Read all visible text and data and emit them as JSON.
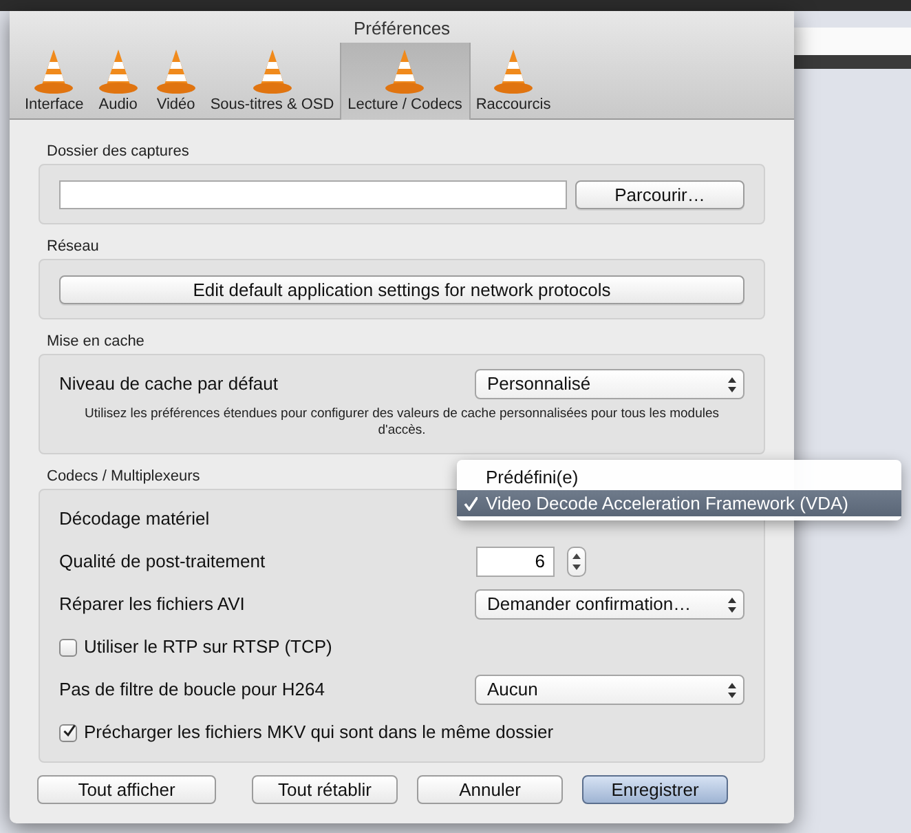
{
  "window": {
    "title": "Préférences"
  },
  "tabs": [
    {
      "label": "Interface",
      "selected": false
    },
    {
      "label": "Audio",
      "selected": false
    },
    {
      "label": "Vidéo",
      "selected": false
    },
    {
      "label": "Sous-titres & OSD",
      "selected": false
    },
    {
      "label": "Lecture / Codecs",
      "selected": true
    },
    {
      "label": "Raccourcis",
      "selected": false
    }
  ],
  "sections": [
    {
      "title": "Dossier des captures",
      "items": [
        {
          "kind": "path",
          "button": "Parcourir…"
        }
      ]
    },
    {
      "title": "Réseau",
      "items": [
        {
          "kind": "button",
          "label": "Edit default application settings for network protocols"
        }
      ]
    },
    {
      "title": "Mise en cache",
      "items": [
        {
          "kind": "select",
          "label": "Niveau de cache par défaut",
          "value": "Personnalisé"
        },
        {
          "kind": "note",
          "text": "Utilisez les préférences étendues pour configurer des valeurs de cache personnalisées pour tous les modules d'accès."
        }
      ]
    },
    {
      "title": "Codecs / Multiplexeurs",
      "items": [
        {
          "kind": "popup",
          "label": "Décodage matériel"
        },
        {
          "kind": "spin",
          "label": "Qualité de post-traitement",
          "value": "6"
        },
        {
          "kind": "select",
          "label": "Réparer les fichiers AVI",
          "value": "Demander confirmation…"
        },
        {
          "kind": "checkbox",
          "label": "Utiliser le RTP sur RTSP (TCP)",
          "checked": false
        },
        {
          "kind": "select",
          "label": "Pas de filtre de boucle pour H264",
          "value": "Aucun"
        },
        {
          "kind": "checkbox",
          "label": "Précharger les fichiers MKV qui sont dans le même dossier",
          "checked": true
        }
      ]
    }
  ],
  "popup_menu": {
    "items": [
      {
        "label": "Prédéfini(e)",
        "selected": false
      },
      {
        "label": "Video Decode Acceleration Framework (VDA)",
        "selected": true
      }
    ]
  },
  "buttons_left": [
    {
      "label": "Tout afficher",
      "default": false
    }
  ],
  "buttons_right": [
    {
      "label": "Tout rétablir",
      "default": false
    },
    {
      "label": "Annuler",
      "default": false
    },
    {
      "label": "Enregistrer",
      "default": true
    }
  ]
}
